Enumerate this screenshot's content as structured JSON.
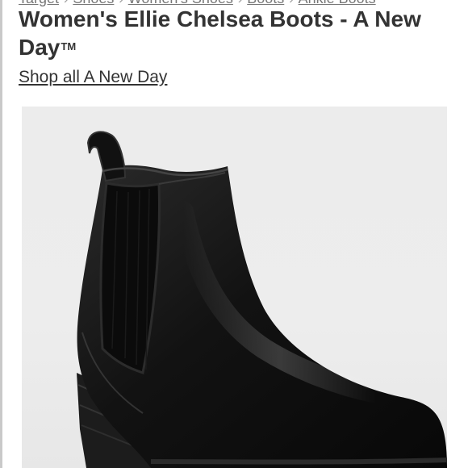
{
  "breadcrumb": [
    "Target",
    "Shoes",
    "Women's Shoes",
    "Boots",
    "Ankle Boots"
  ],
  "product": {
    "title": "Women's Ellie Chelsea Boots - A New Day",
    "trademark": "TM",
    "brand_link": "Shop all A New Day",
    "image_subject": "black-chelsea-boot"
  },
  "colors": {
    "title": "#333333",
    "image_bg": "#ececec",
    "boot": "#151515"
  }
}
